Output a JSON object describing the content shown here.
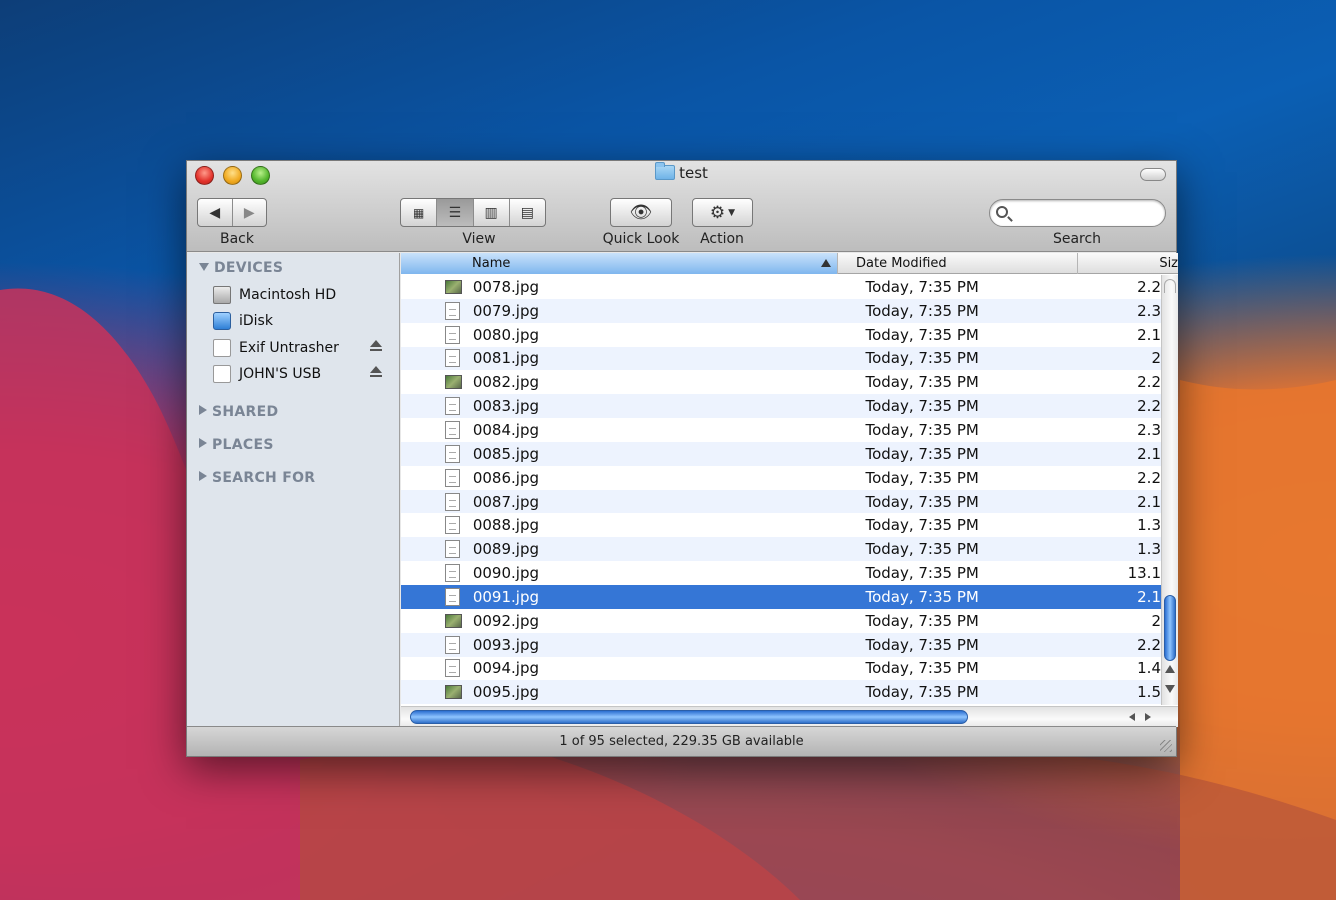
{
  "window": {
    "title": "test"
  },
  "toolbar": {
    "back_label": "Back",
    "view_label": "View",
    "quicklook_label": "Quick Look",
    "action_label": "Action",
    "search_label": "Search",
    "search_placeholder": ""
  },
  "sidebar": {
    "devices_header": "DEVICES",
    "devices": [
      {
        "label": "Macintosh HD",
        "icon": "hard-drive-icon"
      },
      {
        "label": "iDisk",
        "icon": "idisk-icon"
      },
      {
        "label": "Exif Untrasher",
        "icon": "volume-icon",
        "eject": true
      },
      {
        "label": "JOHN'S USB",
        "icon": "volume-icon",
        "eject": true
      }
    ],
    "shared_header": "SHARED",
    "places_header": "PLACES",
    "searchfor_header": "SEARCH FOR"
  },
  "list": {
    "columns": {
      "name": "Name",
      "date": "Date Modified",
      "size": "Siz"
    },
    "rows": [
      {
        "name": "0078.jpg",
        "date": "Today, 7:35 PM",
        "size": "2.2",
        "thumb": true
      },
      {
        "name": "0079.jpg",
        "date": "Today, 7:35 PM",
        "size": "2.3",
        "thumb": false
      },
      {
        "name": "0080.jpg",
        "date": "Today, 7:35 PM",
        "size": "2.1",
        "thumb": false
      },
      {
        "name": "0081.jpg",
        "date": "Today, 7:35 PM",
        "size": "2",
        "thumb": false
      },
      {
        "name": "0082.jpg",
        "date": "Today, 7:35 PM",
        "size": "2.2",
        "thumb": true
      },
      {
        "name": "0083.jpg",
        "date": "Today, 7:35 PM",
        "size": "2.2",
        "thumb": false
      },
      {
        "name": "0084.jpg",
        "date": "Today, 7:35 PM",
        "size": "2.3",
        "thumb": false
      },
      {
        "name": "0085.jpg",
        "date": "Today, 7:35 PM",
        "size": "2.1",
        "thumb": false
      },
      {
        "name": "0086.jpg",
        "date": "Today, 7:35 PM",
        "size": "2.2",
        "thumb": false
      },
      {
        "name": "0087.jpg",
        "date": "Today, 7:35 PM",
        "size": "2.1",
        "thumb": false
      },
      {
        "name": "0088.jpg",
        "date": "Today, 7:35 PM",
        "size": "1.3",
        "thumb": false
      },
      {
        "name": "0089.jpg",
        "date": "Today, 7:35 PM",
        "size": "1.3",
        "thumb": false
      },
      {
        "name": "0090.jpg",
        "date": "Today, 7:35 PM",
        "size": "13.1",
        "thumb": false
      },
      {
        "name": "0091.jpg",
        "date": "Today, 7:35 PM",
        "size": "2.1",
        "thumb": false,
        "selected": true
      },
      {
        "name": "0092.jpg",
        "date": "Today, 7:35 PM",
        "size": "2",
        "thumb": true
      },
      {
        "name": "0093.jpg",
        "date": "Today, 7:35 PM",
        "size": "2.2",
        "thumb": false
      },
      {
        "name": "0094.jpg",
        "date": "Today, 7:35 PM",
        "size": "1.4",
        "thumb": false
      },
      {
        "name": "0095.jpg",
        "date": "Today, 7:35 PM",
        "size": "1.5",
        "thumb": true
      }
    ]
  },
  "status": {
    "text": "1 of 95 selected, 229.35 GB available"
  },
  "colors": {
    "selection": "#3576d6",
    "accent": "#2b6fd1"
  }
}
